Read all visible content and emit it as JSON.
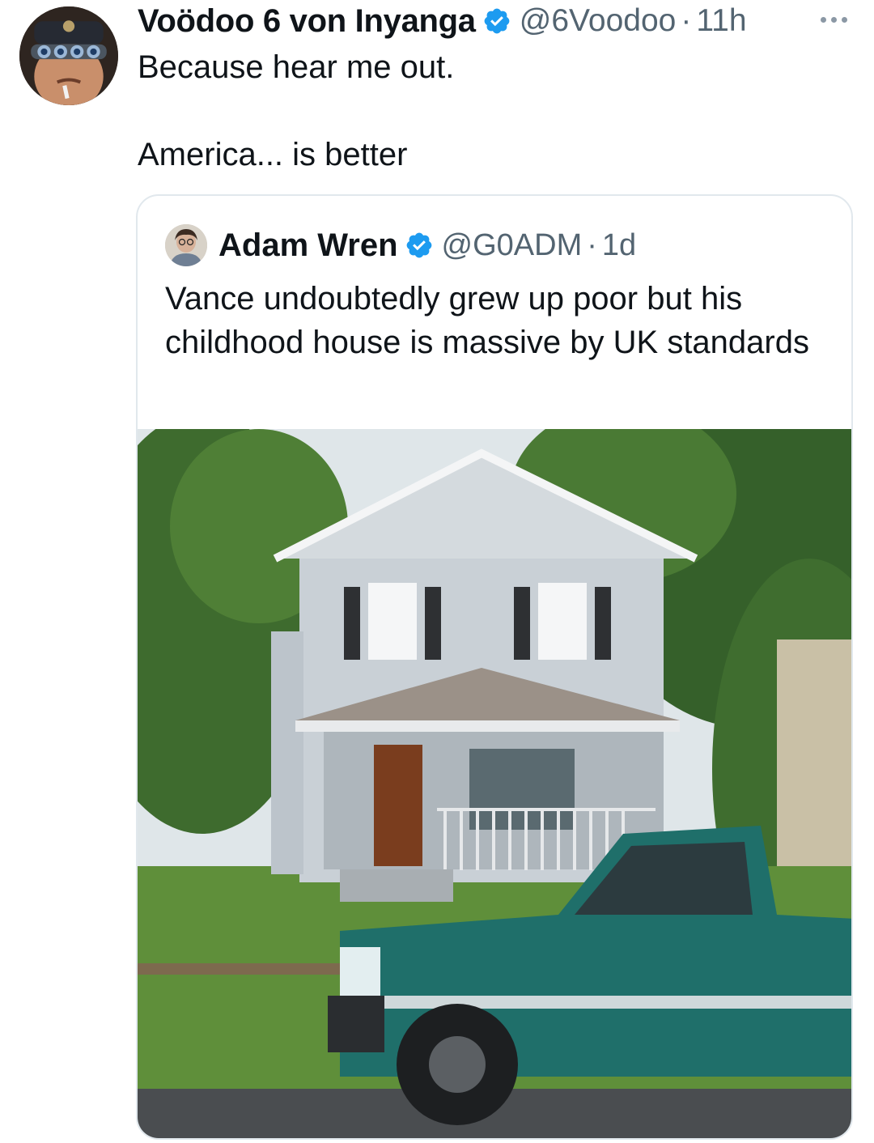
{
  "tweet": {
    "author_name": "Voödoo 6 von Inyanga",
    "handle": "@6Voodoo",
    "separator": "·",
    "time": "11h",
    "text": "Because hear me out.\n\nAmerica... is better",
    "avatar_icon": "avatar-photo",
    "verified_icon": "verified-badge-icon",
    "more_icon": "more-options-icon"
  },
  "quote": {
    "author_name": "Adam Wren",
    "handle": "@G0ADM",
    "separator": "·",
    "time": "1d",
    "text": "Vance undoubtedly grew up poor but his childhood house is massive by UK standards",
    "avatar_icon": "avatar-photo",
    "verified_icon": "verified-badge-icon",
    "image": "house-with-pickup-truck-photo"
  },
  "colors": {
    "verified": "#1d9bf0",
    "secondary_text": "#536471",
    "border": "#e1e8ed"
  }
}
